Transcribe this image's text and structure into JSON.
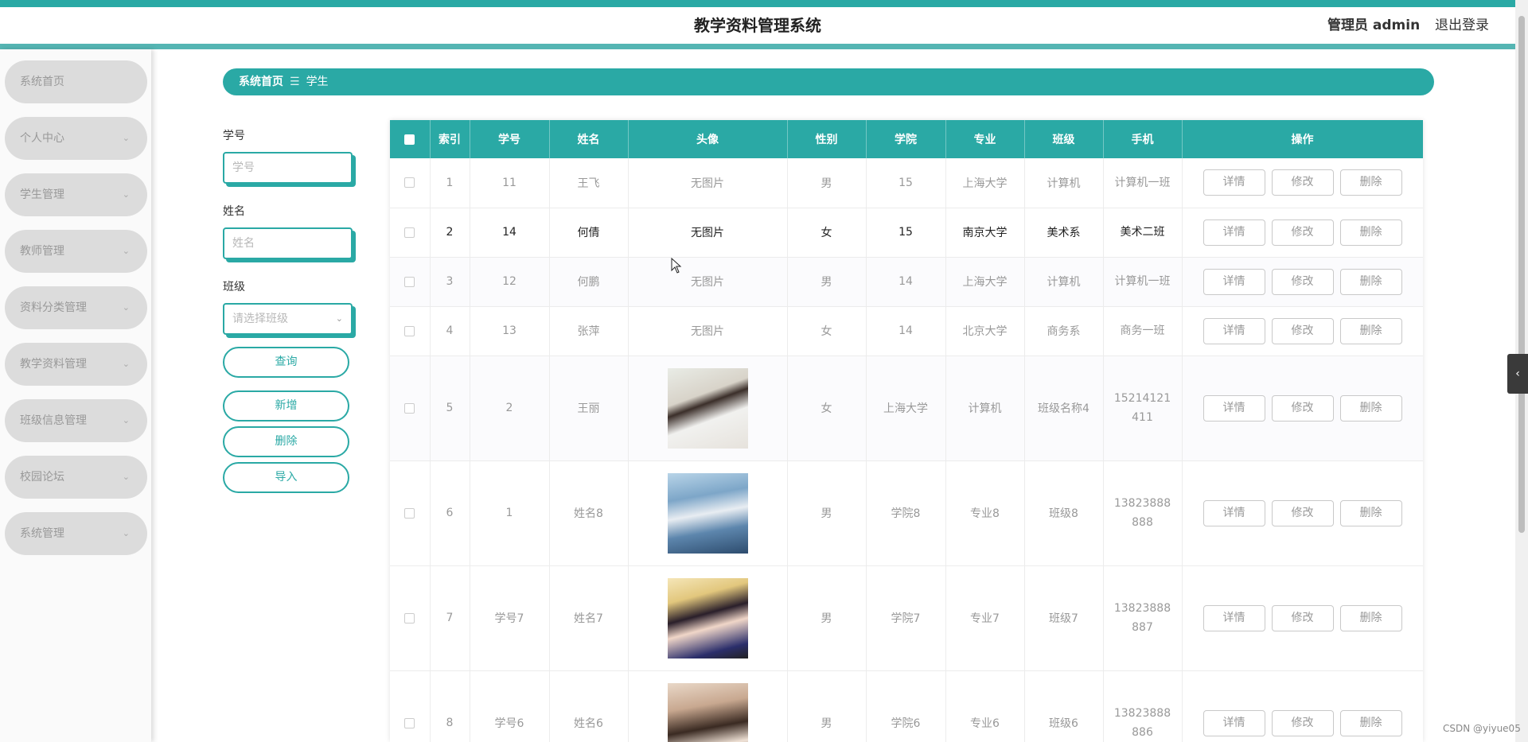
{
  "header": {
    "title": "教学资料管理系统",
    "user_label": "管理员 admin",
    "logout_label": "退出登录"
  },
  "sidebar": {
    "items": [
      {
        "label": "系统首页",
        "has_chevron": false
      },
      {
        "label": "个人中心",
        "has_chevron": true
      },
      {
        "label": "学生管理",
        "has_chevron": true
      },
      {
        "label": "教师管理",
        "has_chevron": true
      },
      {
        "label": "资料分类管理",
        "has_chevron": true
      },
      {
        "label": "教学资料管理",
        "has_chevron": true
      },
      {
        "label": "班级信息管理",
        "has_chevron": true
      },
      {
        "label": "校园论坛",
        "has_chevron": true
      },
      {
        "label": "系统管理",
        "has_chevron": true
      }
    ]
  },
  "breadcrumb": {
    "home": "系统首页",
    "separator": "☰",
    "current": "学生"
  },
  "search": {
    "student_no_label": "学号",
    "student_no_placeholder": "学号",
    "name_label": "姓名",
    "name_placeholder": "姓名",
    "class_label": "班级",
    "class_placeholder": "请选择班级",
    "query_button": "查询",
    "add_button": "新增",
    "delete_button": "删除",
    "import_button": "导入"
  },
  "table": {
    "columns": [
      "索引",
      "学号",
      "姓名",
      "头像",
      "性别",
      "学院",
      "专业",
      "班级",
      "手机",
      "操作"
    ],
    "no_image_text": "无图片",
    "action_labels": {
      "detail": "详情",
      "edit": "修改",
      "delete": "删除"
    },
    "rows": [
      {
        "index": "1",
        "student_no": "11",
        "name": "王飞",
        "avatar": "",
        "gender": "男",
        "college": "15",
        "major": "上海大学",
        "class": "计算机",
        "phone": "计算机一班"
      },
      {
        "index": "2",
        "student_no": "14",
        "name": "何倩",
        "avatar": "",
        "gender": "女",
        "college": "15",
        "major": "南京大学",
        "class": "美术系",
        "phone": "美术二班"
      },
      {
        "index": "3",
        "student_no": "12",
        "name": "何鹏",
        "avatar": "",
        "gender": "男",
        "college": "14",
        "major": "上海大学",
        "class": "计算机",
        "phone": "计算机一班"
      },
      {
        "index": "4",
        "student_no": "13",
        "name": "张萍",
        "avatar": "",
        "gender": "女",
        "college": "14",
        "major": "北京大学",
        "class": "商务系",
        "phone": "商务一班"
      },
      {
        "index": "5",
        "student_no": "2",
        "name": "王丽",
        "avatar": "photo-1",
        "gender": "女",
        "college": "上海大学",
        "major": "计算机",
        "class": "班级名称4",
        "phone": "15214121411"
      },
      {
        "index": "6",
        "student_no": "1",
        "name": "姓名8",
        "avatar": "photo-2",
        "gender": "男",
        "college": "学院8",
        "major": "专业8",
        "class": "班级8",
        "phone": "13823888888"
      },
      {
        "index": "7",
        "student_no": "学号7",
        "name": "姓名7",
        "avatar": "photo-3",
        "gender": "男",
        "college": "学院7",
        "major": "专业7",
        "class": "班级7",
        "phone": "13823888887"
      },
      {
        "index": "8",
        "student_no": "学号6",
        "name": "姓名6",
        "avatar": "photo-4",
        "gender": "男",
        "college": "学院6",
        "major": "专业6",
        "class": "班级6",
        "phone": "13823888886"
      }
    ]
  },
  "watermark": "CSDN @yiyue05",
  "colors": {
    "accent": "#2aa9a5",
    "sidebar_item_bg": "#dcdcdc",
    "header_border": "#55b5b3"
  }
}
